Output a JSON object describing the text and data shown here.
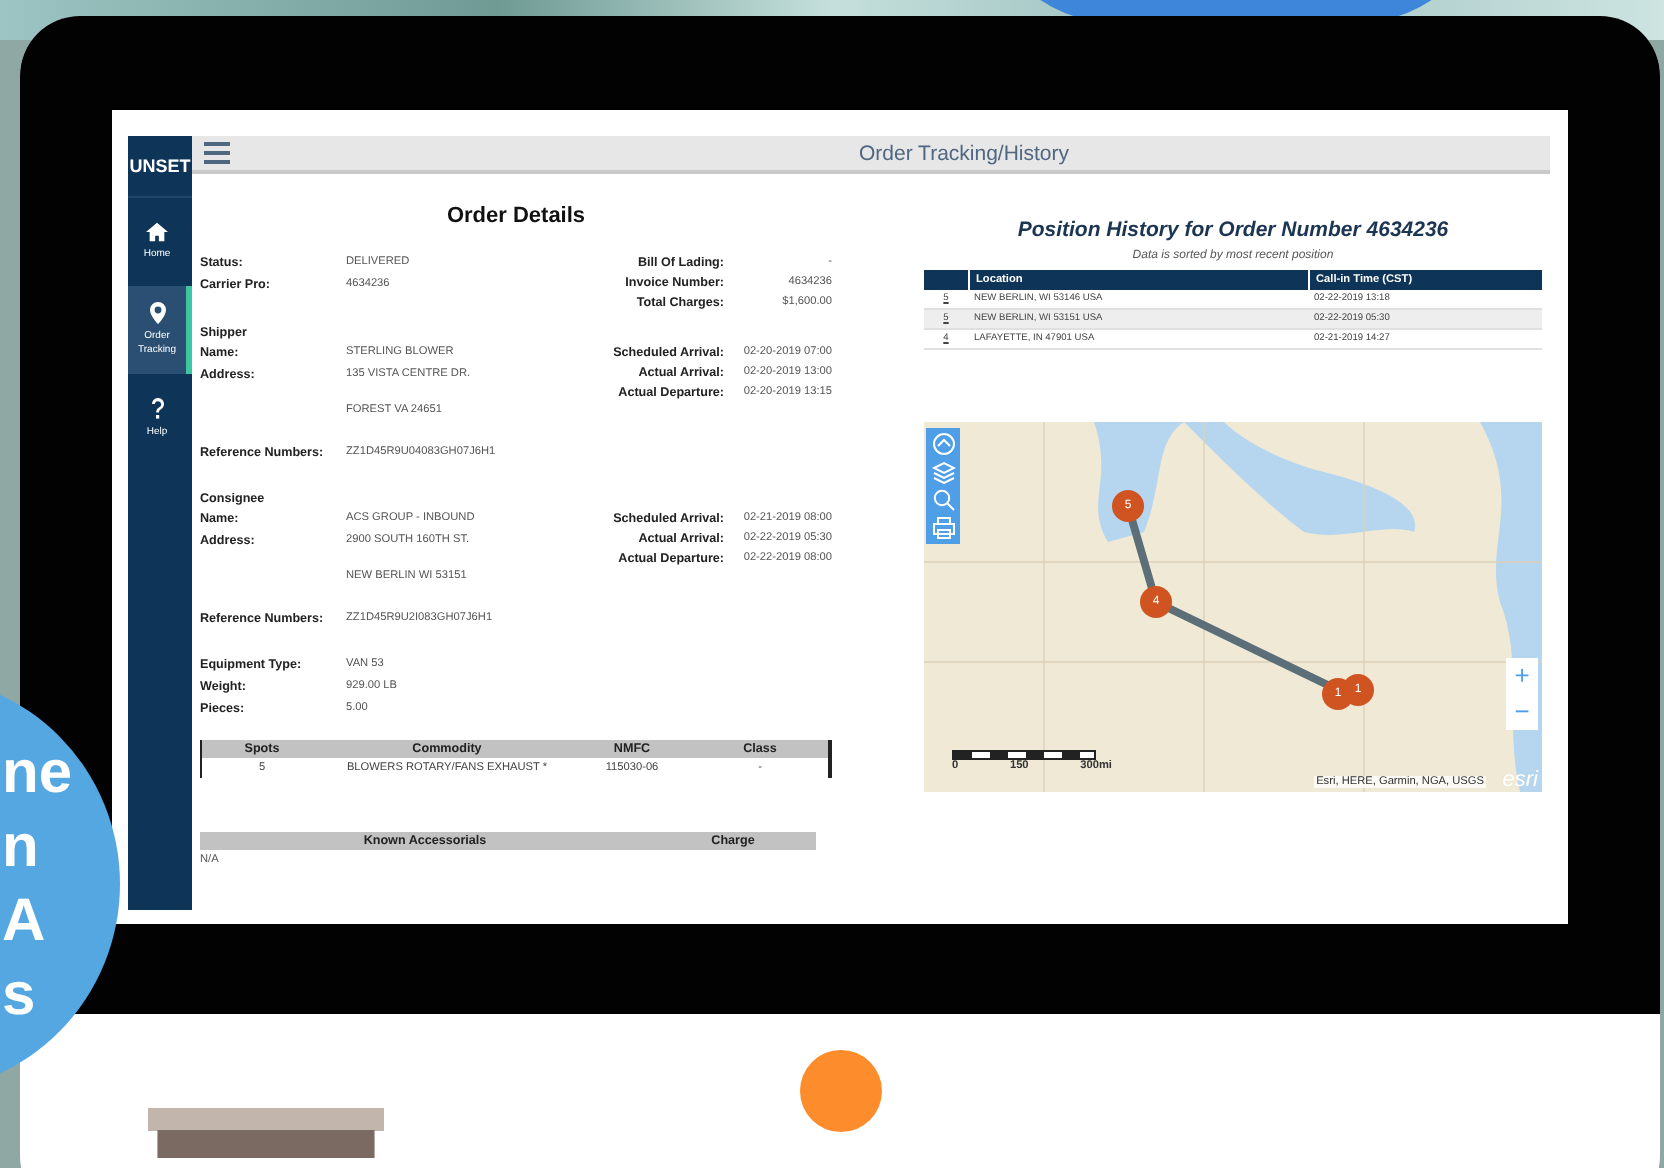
{
  "promo_badge": {
    "lines": [
      "ne",
      "n",
      "A",
      "s"
    ]
  },
  "app": {
    "header": {
      "title": "Order Tracking/History"
    },
    "logo": {
      "text": "UNSET"
    },
    "sidebar": {
      "items": [
        {
          "kind": "home",
          "label": "Home",
          "selected": false
        },
        {
          "kind": "pin",
          "label": "Order Tracking",
          "selected": true
        },
        {
          "kind": "help",
          "label": "Help",
          "selected": false
        }
      ]
    },
    "order_details": {
      "title": "Order Details",
      "sections": [
        {
          "left": [
            {
              "label": "Status:",
              "lines": [
                "DELIVERED"
              ]
            },
            {
              "label": "Carrier Pro:",
              "lines": [
                "4634236"
              ]
            }
          ],
          "right": [
            {
              "label": "Bill Of Lading:",
              "value": "-"
            },
            {
              "label": "Invoice Number:",
              "value": "4634236"
            },
            {
              "label": "Total Charges:",
              "value": "$1,600.00"
            }
          ]
        },
        {
          "heading": "Shipper",
          "left": [
            {
              "label": "Name:",
              "lines": [
                "STERLING BLOWER"
              ]
            },
            {
              "label": "Address:",
              "lines": [
                "135 VISTA CENTRE DR.",
                "FOREST VA 24651"
              ]
            }
          ],
          "right": [
            {
              "label": "Scheduled Arrival:",
              "value": "02-20-2019 07:00"
            },
            {
              "label": "Actual Arrival:",
              "value": "02-20-2019 13:00"
            },
            {
              "label": "Actual Departure:",
              "value": "02-20-2019 13:15"
            }
          ]
        },
        {
          "left": [
            {
              "label": "Reference Numbers:",
              "lines": [
                "ZZ1D45R9U04083GH07J6H1"
              ]
            }
          ]
        },
        {
          "heading": "Consignee",
          "left": [
            {
              "label": "Name:",
              "lines": [
                "ACS GROUP - INBOUND"
              ]
            },
            {
              "label": "Address:",
              "lines": [
                "2900 SOUTH 160TH ST.",
                "NEW BERLIN WI 53151"
              ]
            }
          ],
          "right": [
            {
              "label": "Scheduled Arrival:",
              "value": "02-21-2019 08:00"
            },
            {
              "label": "Actual Arrival:",
              "value": "02-22-2019 05:30"
            },
            {
              "label": "Actual Departure:",
              "value": "02-22-2019 08:00"
            }
          ]
        },
        {
          "left": [
            {
              "label": "Reference Numbers:",
              "lines": [
                "ZZ1D45R9U2I083GH07J6H1"
              ]
            }
          ]
        },
        {
          "left": [
            {
              "label": "Equipment Type:",
              "lines": [
                "VAN 53"
              ]
            },
            {
              "label": "Weight:",
              "lines": [
                "929.00 LB"
              ]
            },
            {
              "label": "Pieces:",
              "lines": [
                "5.00"
              ]
            }
          ]
        }
      ],
      "commodity_table": {
        "columns": [
          "Spots",
          "Commodity",
          "NMFC",
          "Class"
        ],
        "rows": [
          [
            "5",
            "BLOWERS ROTARY/FANS EXHAUST *",
            "115030-06",
            "-"
          ]
        ]
      },
      "accessorials_table": {
        "columns": [
          "Known Accessorials",
          "Charge"
        ],
        "note": "N/A"
      }
    },
    "position_history": {
      "title": "Position History for Order Number 4634236",
      "subtitle": "Data is sorted by most recent position",
      "columns": [
        "Location",
        "Call-in Time (CST)"
      ],
      "rows": [
        {
          "stop": "5",
          "location": "NEW BERLIN, WI 53146 USA",
          "time": "02-22-2019 13:18"
        },
        {
          "stop": "5",
          "location": "NEW BERLIN, WI 53151 USA",
          "time": "02-22-2019 05:30"
        },
        {
          "stop": "4",
          "location": "LAFAYETTE, IN 47901 USA",
          "time": "02-21-2019 14:27"
        }
      ],
      "map": {
        "tools": [
          {
            "kind": "home"
          },
          {
            "kind": "layers"
          },
          {
            "kind": "search"
          },
          {
            "kind": "print"
          }
        ],
        "markers": [
          "5",
          "4",
          "1",
          "1"
        ],
        "zoom": [
          "+",
          "−"
        ],
        "scale": [
          "0",
          "150",
          "300mi"
        ],
        "attribution": "Esri, HERE, Garmin, NGA, USGS",
        "brand": "esri"
      }
    }
  }
}
